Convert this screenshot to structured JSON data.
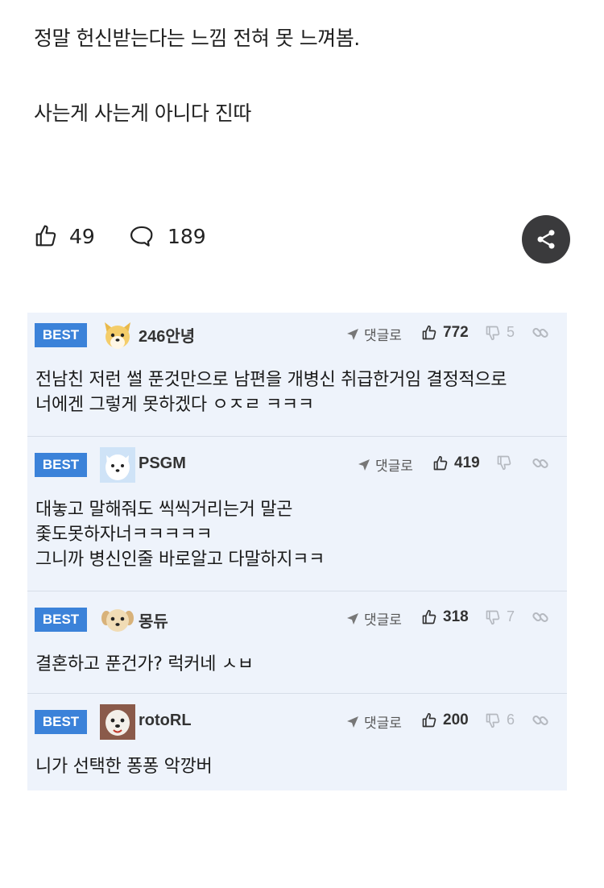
{
  "post": {
    "lines": [
      "정말 헌신받는다는 느낌 전혀 못 느껴봄.",
      "사는게 사는게 아니다 진따"
    ],
    "likes": "49",
    "comments": "189"
  },
  "comments": [
    {
      "badge": "BEST",
      "nickname": "246안녕",
      "reply_label": "댓글로",
      "upvotes": "772",
      "downvotes": "5",
      "lines": [
        "전남친 저런 썰 푼것만으로 남편을 개병신 취급한거임 결정적으로",
        "너에겐 그렇게 못하겠다 ㅇㅈㄹ ㅋㅋㅋ"
      ]
    },
    {
      "badge": "BEST",
      "nickname": "PSGM",
      "reply_label": "댓글로",
      "upvotes": "419",
      "downvotes": "",
      "lines": [
        "대놓고 말해줘도 씩씩거리는거 말곤",
        "좇도못하자너ㅋㅋㅋㅋㅋ",
        "그니까 병신인줄 바로알고 다말하지ㅋㅋ"
      ]
    },
    {
      "badge": "BEST",
      "nickname": "몽듀",
      "reply_label": "댓글로",
      "upvotes": "318",
      "downvotes": "7",
      "lines": [
        "결혼하고 푼건가? 럭커네 ㅅㅂ"
      ]
    },
    {
      "badge": "BEST",
      "nickname": "rotoRL",
      "reply_label": "댓글로",
      "upvotes": "200",
      "downvotes": "6",
      "lines": [
        "니가 선택한 퐁퐁 악깡버"
      ]
    }
  ],
  "colors": {
    "best_badge": "#3b82d9",
    "comment_bg": "#eef3fb",
    "share_button": "#3a3a3c"
  },
  "icons": [
    "thumbs-up-icon",
    "comment-bubble-icon",
    "share-icon",
    "reply-arrow-icon",
    "thumbs-down-icon",
    "link-icon"
  ]
}
